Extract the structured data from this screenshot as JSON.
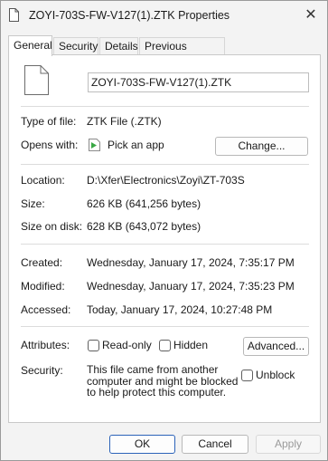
{
  "window": {
    "title": "ZOYI-703S-FW-V127(1).ZTK Properties",
    "close_glyph": "✕"
  },
  "tabs": [
    {
      "label": "General",
      "active": true
    },
    {
      "label": "Security",
      "active": false
    },
    {
      "label": "Details",
      "active": false
    },
    {
      "label": "Previous Versions",
      "active": false
    }
  ],
  "general": {
    "file_name": "ZOYI-703S-FW-V127(1).ZTK",
    "type_label": "Type of file:",
    "type_value": "ZTK File (.ZTK)",
    "opens_label": "Opens with:",
    "opens_value": "Pick an app",
    "change_button": "Change...",
    "location_label": "Location:",
    "location_value": "D:\\Xfer\\Electronics\\Zoyi\\ZT-703S",
    "size_label": "Size:",
    "size_value": "626 KB (641,256 bytes)",
    "size_on_disk_label": "Size on disk:",
    "size_on_disk_value": "628 KB (643,072 bytes)",
    "created_label": "Created:",
    "created_value": "Wednesday, January 17, 2024, 7:35:17 PM",
    "modified_label": "Modified:",
    "modified_value": "Wednesday, January 17, 2024, 7:35:23 PM",
    "accessed_label": "Accessed:",
    "accessed_value": "Today, January 17, 2024, 10:27:48 PM",
    "attributes_label": "Attributes:",
    "readonly_label": "Read-only",
    "readonly_checked": false,
    "hidden_label": "Hidden",
    "hidden_checked": false,
    "advanced_button": "Advanced...",
    "security_label": "Security:",
    "security_text": "This file came from another computer and might be blocked to help protect this computer.",
    "unblock_label": "Unblock",
    "unblock_checked": false
  },
  "footer": {
    "ok": "OK",
    "cancel": "Cancel",
    "apply": "Apply"
  },
  "colors": {
    "ok_border": "#2b62b8",
    "app_icon_green": "#3aa845"
  }
}
